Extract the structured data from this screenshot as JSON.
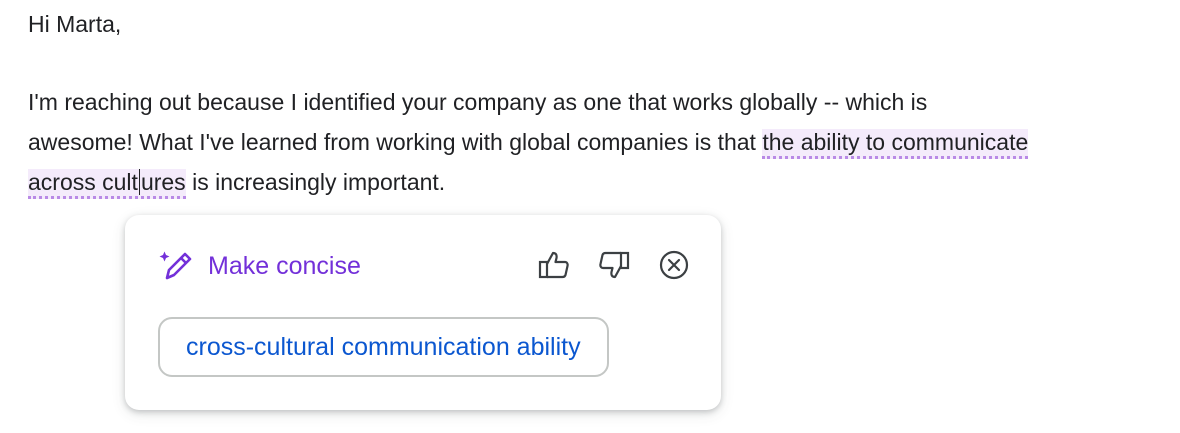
{
  "email": {
    "greeting": "Hi Marta,",
    "line1": "I'm reaching out because I identified your company as one that works globally -- which is",
    "line2_prefix": "awesome! What I've learned from working with global companies is that ",
    "highlight_part1": "the ability to communicate",
    "highlight_part2_before_caret": "across cult",
    "highlight_part2_after_caret": "ures",
    "line3_suffix": " is increasingly important."
  },
  "popup": {
    "title": "Make concise",
    "suggestion": "cross-cultural communication ability",
    "icons": {
      "title_icon": "magic-wand-sparkle-icon",
      "like": "thumbs-up-icon",
      "dislike": "thumbs-down-icon",
      "close": "close-circle-icon"
    }
  },
  "colors": {
    "accent_purple": "#7330d9",
    "suggestion_blue": "#0b57d0",
    "highlight_bg": "#f4ebfb",
    "highlight_underline": "#b98ae6",
    "text": "#202124"
  }
}
